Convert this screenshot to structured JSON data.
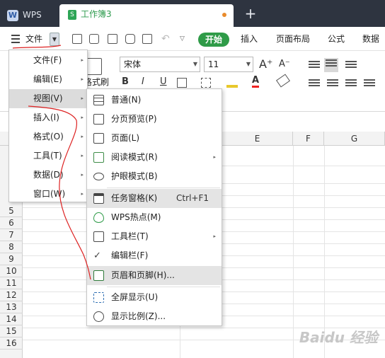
{
  "tabs": {
    "app": "WPS",
    "doc": "工作簿3",
    "new_tab": "+"
  },
  "menubar": {
    "file": "文件",
    "items": [
      "开始",
      "插入",
      "页面布局",
      "公式",
      "数据"
    ]
  },
  "ribbon": {
    "font_name": "宋体",
    "font_size": "11",
    "format_painter": "格式刷",
    "grow_font": "A⁺",
    "shrink_font": "A⁻",
    "bold": "B",
    "italic": "I",
    "underline": "U"
  },
  "columns": [
    "E",
    "F",
    "G"
  ],
  "rows": [
    "5",
    "6",
    "7",
    "8",
    "9",
    "10",
    "11",
    "12",
    "13",
    "14",
    "15",
    "16"
  ],
  "main_menu": [
    {
      "label": "文件(F)",
      "arrow": "▸"
    },
    {
      "label": "编辑(E)",
      "arrow": "▸"
    },
    {
      "label": "视图(V)",
      "arrow": "▸"
    },
    {
      "label": "插入(I)",
      "arrow": "▸"
    },
    {
      "label": "格式(O)",
      "arrow": "▸"
    },
    {
      "label": "工具(T)",
      "arrow": "▸"
    },
    {
      "label": "数据(D)",
      "arrow": "▸"
    },
    {
      "label": "窗口(W)",
      "arrow": "▸"
    }
  ],
  "view_menu": [
    {
      "label": "普通(N)",
      "icon": "grid-icon"
    },
    {
      "label": "分页预览(P)",
      "icon": "page-break-icon"
    },
    {
      "label": "页面(L)",
      "icon": "page-icon"
    },
    {
      "label": "阅读模式(R)",
      "icon": "reading-mode-icon",
      "arrow": "▸"
    },
    {
      "label": "护眼模式(B)",
      "icon": "eye-icon"
    },
    {
      "label": "任务窗格(K)",
      "icon": "task-pane-icon",
      "shortcut": "Ctrl+F1"
    },
    {
      "label": "WPS热点(M)",
      "icon": "flame-icon"
    },
    {
      "label": "工具栏(T)",
      "icon": "toolbar-icon",
      "arrow": "▸"
    },
    {
      "label": "编辑栏(F)",
      "icon": "check-icon"
    },
    {
      "label": "页眉和页脚(H)...",
      "icon": "header-footer-icon"
    },
    {
      "label": "全屏显示(U)",
      "icon": "fullscreen-icon"
    },
    {
      "label": "显示比例(Z)...",
      "icon": "zoom-icon"
    }
  ],
  "watermark": "Baidu 经验"
}
